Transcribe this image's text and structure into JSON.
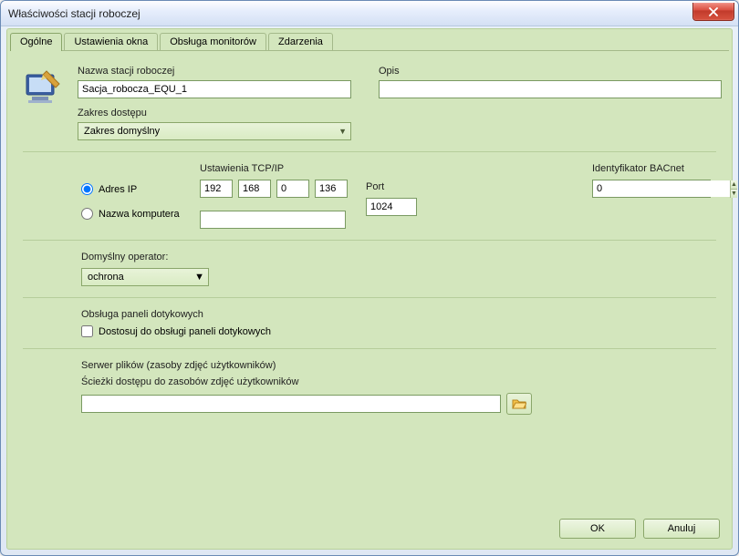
{
  "window": {
    "title": "Właściwości stacji roboczej",
    "close": "X"
  },
  "tabs": {
    "general": "Ogólne",
    "window_settings": "Ustawienia okna",
    "monitors": "Obsługa monitorów",
    "events": "Zdarzenia"
  },
  "general": {
    "name_label": "Nazwa stacji roboczej",
    "name_value": "Sacja_robocza_EQU_1",
    "desc_label": "Opis",
    "desc_value": "",
    "scope_label": "Zakres dostępu",
    "scope_value": "Zakres domyślny",
    "tcp_label": "Ustawienia TCP/IP",
    "radio_ip": "Adres IP",
    "radio_host": "Nazwa komputera",
    "ip": {
      "a": "192",
      "b": "168",
      "c": "0",
      "d": "136"
    },
    "hostname": "",
    "port_label": "Port",
    "port_value": "1024",
    "bacnet_label": "Identyfikator BACnet",
    "bacnet_value": "0",
    "operator_label": "Domyślny operator:",
    "operator_value": "ochrona",
    "touch_header": "Obsługa paneli dotykowych",
    "touch_checkbox": "Dostosuj do obsługi paneli dotykowych",
    "fileserver_header": "Serwer plików (zasoby zdjęć użytkowników)",
    "fileserver_path_label": "Ścieżki dostępu do zasobów zdjęć użytkowników",
    "fileserver_path_value": ""
  },
  "buttons": {
    "ok": "OK",
    "cancel": "Anuluj"
  }
}
